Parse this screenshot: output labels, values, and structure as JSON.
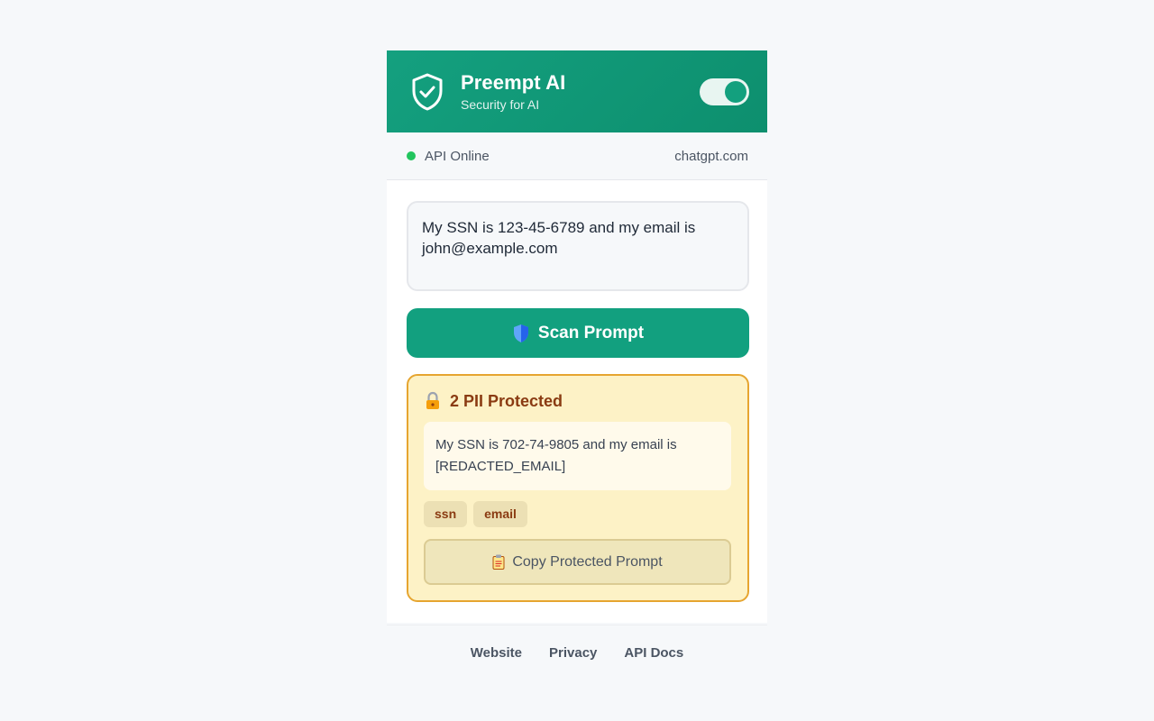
{
  "header": {
    "title": "Preempt AI",
    "subtitle": "Security for AI",
    "toggle_on": true,
    "shield_icon": "shield-check-icon"
  },
  "status": {
    "api_label": "API Online",
    "api_color": "#22c55e",
    "site": "chatgpt.com"
  },
  "prompt": {
    "value": "My SSN is 123-45-6789 and my email is john@example.com"
  },
  "scan_button": {
    "label": "Scan Prompt",
    "icon": "blue-shield-icon"
  },
  "result": {
    "icon": "lock-icon",
    "title": "2 PII Protected",
    "protected_text": "My SSN is 702-74-9805 and my email is [REDACTED_EMAIL]",
    "tags": [
      "ssn",
      "email"
    ],
    "copy_label": "Copy Protected Prompt",
    "copy_icon": "clipboard-icon"
  },
  "footer": {
    "links": [
      "Website",
      "Privacy",
      "API Docs"
    ]
  },
  "colors": {
    "brand": "#12a07f",
    "result_border": "#e6a530",
    "result_bg": "#fdf2c6",
    "result_text": "#8a3b12"
  }
}
